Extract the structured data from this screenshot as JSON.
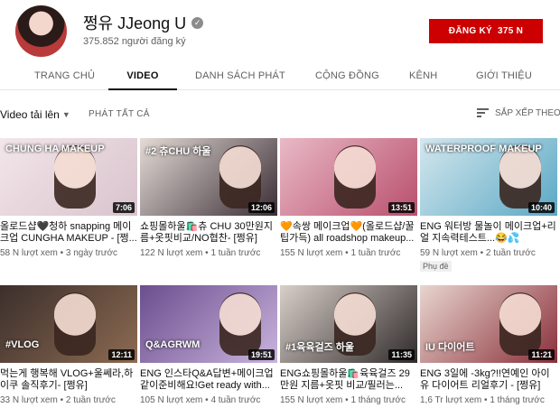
{
  "channel": {
    "name": "쩡유 JJeong U",
    "verified_mark": "✓",
    "subscribers": "375.852 người đăng ký",
    "subscribe_label": "ĐĂNG KÝ",
    "subscribe_count": "375 N"
  },
  "tabs": [
    {
      "label": "TRANG CHỦ"
    },
    {
      "label": "VIDEO"
    },
    {
      "label": "DANH SÁCH PHÁT"
    },
    {
      "label": "CỘNG ĐỒNG"
    },
    {
      "label": "KÊNH"
    },
    {
      "label": "GIỚI THIỆU"
    }
  ],
  "toolbar": {
    "uploads_label": "Video tải lên",
    "play_all": "PHÁT TẤT CẢ",
    "sort_label": "SẮP XẾP THEO"
  },
  "videos": [
    {
      "title": "올로드샵🖤청하 snapping 메이크업 CUNGHA MAKEUP - [쩡...",
      "meta": "58 N lượt xem • 3 ngày trước",
      "duration": "7:06",
      "overlay": "CHUNG HA MAKEUP",
      "bg": "#f2e6ea",
      "accent": "#d9c3cc"
    },
    {
      "title": "쇼핑몰하울🛍️츄 CHU 30만원지름+옷핏비교/NO협찬- [쩡유]",
      "meta": "122 N lượt xem • 1 tuần trước",
      "duration": "12:06",
      "overlay": "#2 츄CHU 하울",
      "bg": "#e4dbd6",
      "accent": "#3a2d35"
    },
    {
      "title": "🧡속쌍 메이크업🧡(올로드샵/꿀팁가득) all roadshop makeup...",
      "meta": "155 N lượt xem • 1 tuần trước",
      "duration": "13:51",
      "overlay": "",
      "bg": "#e9b9c6",
      "accent": "#b94f6d"
    },
    {
      "title": "ENG 워터방 물놀이 메이크업+리얼 지속력테스트...😂💦",
      "meta": "59 N lượt xem • 2 tuần trước",
      "duration": "10:40",
      "overlay": "WATERPROOF MAKEUP",
      "bg": "#d4e7ee",
      "accent": "#5aa8c4",
      "badge": "Phụ đề"
    },
    {
      "title": "먹는게 행복해 VLOG+울쎄라,하이쿠 솔직후기- [쩡유]",
      "meta": "33 N lượt xem • 2 tuần trước",
      "duration": "12:11",
      "overlay": "#VLOG",
      "bg": "#3b2f2b",
      "accent": "#8d6b52"
    },
    {
      "title": "ENG 인스타Q&A답변+메이크업 같이준비해요!Get ready with...",
      "meta": "105 N lượt xem • 4 tuần trước",
      "duration": "19:51",
      "overlay": "Q&AGRWM",
      "bg": "#6b4e8e",
      "accent": "#c9b3dd"
    },
    {
      "title": "ENG쇼핑몰하울🛍️육육걸즈 29만원 지름+옷핏 비교/필러는...",
      "meta": "155 N lượt xem • 1 tháng trước",
      "duration": "11:35",
      "overlay": "#1육육걸즈 하울",
      "bg": "#d9cfc9",
      "accent": "#2f2a2a"
    },
    {
      "title": "ENG 3일에 -3kg?!!연예인 아이유 다이어트 리얼후기 - [쩡유]",
      "meta": "1,6 Tr lượt xem • 1 tháng trước",
      "duration": "11:21",
      "overlay": "IU 다이어트",
      "bg": "#e8d5ce",
      "accent": "#8a2f3a"
    }
  ]
}
